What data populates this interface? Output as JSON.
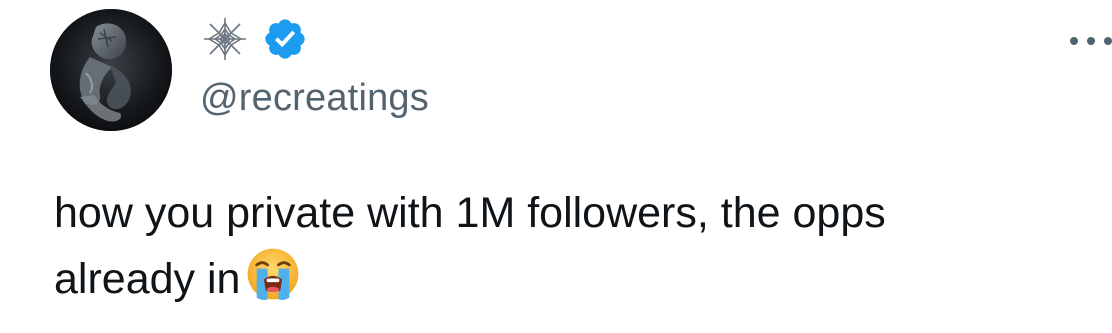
{
  "tweet": {
    "author": {
      "avatar_icon": "spider-man-avatar",
      "name_icon": "spider-web-icon",
      "verified_icon": "verified-badge-icon",
      "verified_color": "#1d9bf0",
      "handle": "@recreatings"
    },
    "more_icon": "more-options-icon",
    "text_line_1": "how you private with 1M followers, the opps",
    "text_line_2": "already in",
    "emoji": "loudly-crying-face-emoji"
  }
}
